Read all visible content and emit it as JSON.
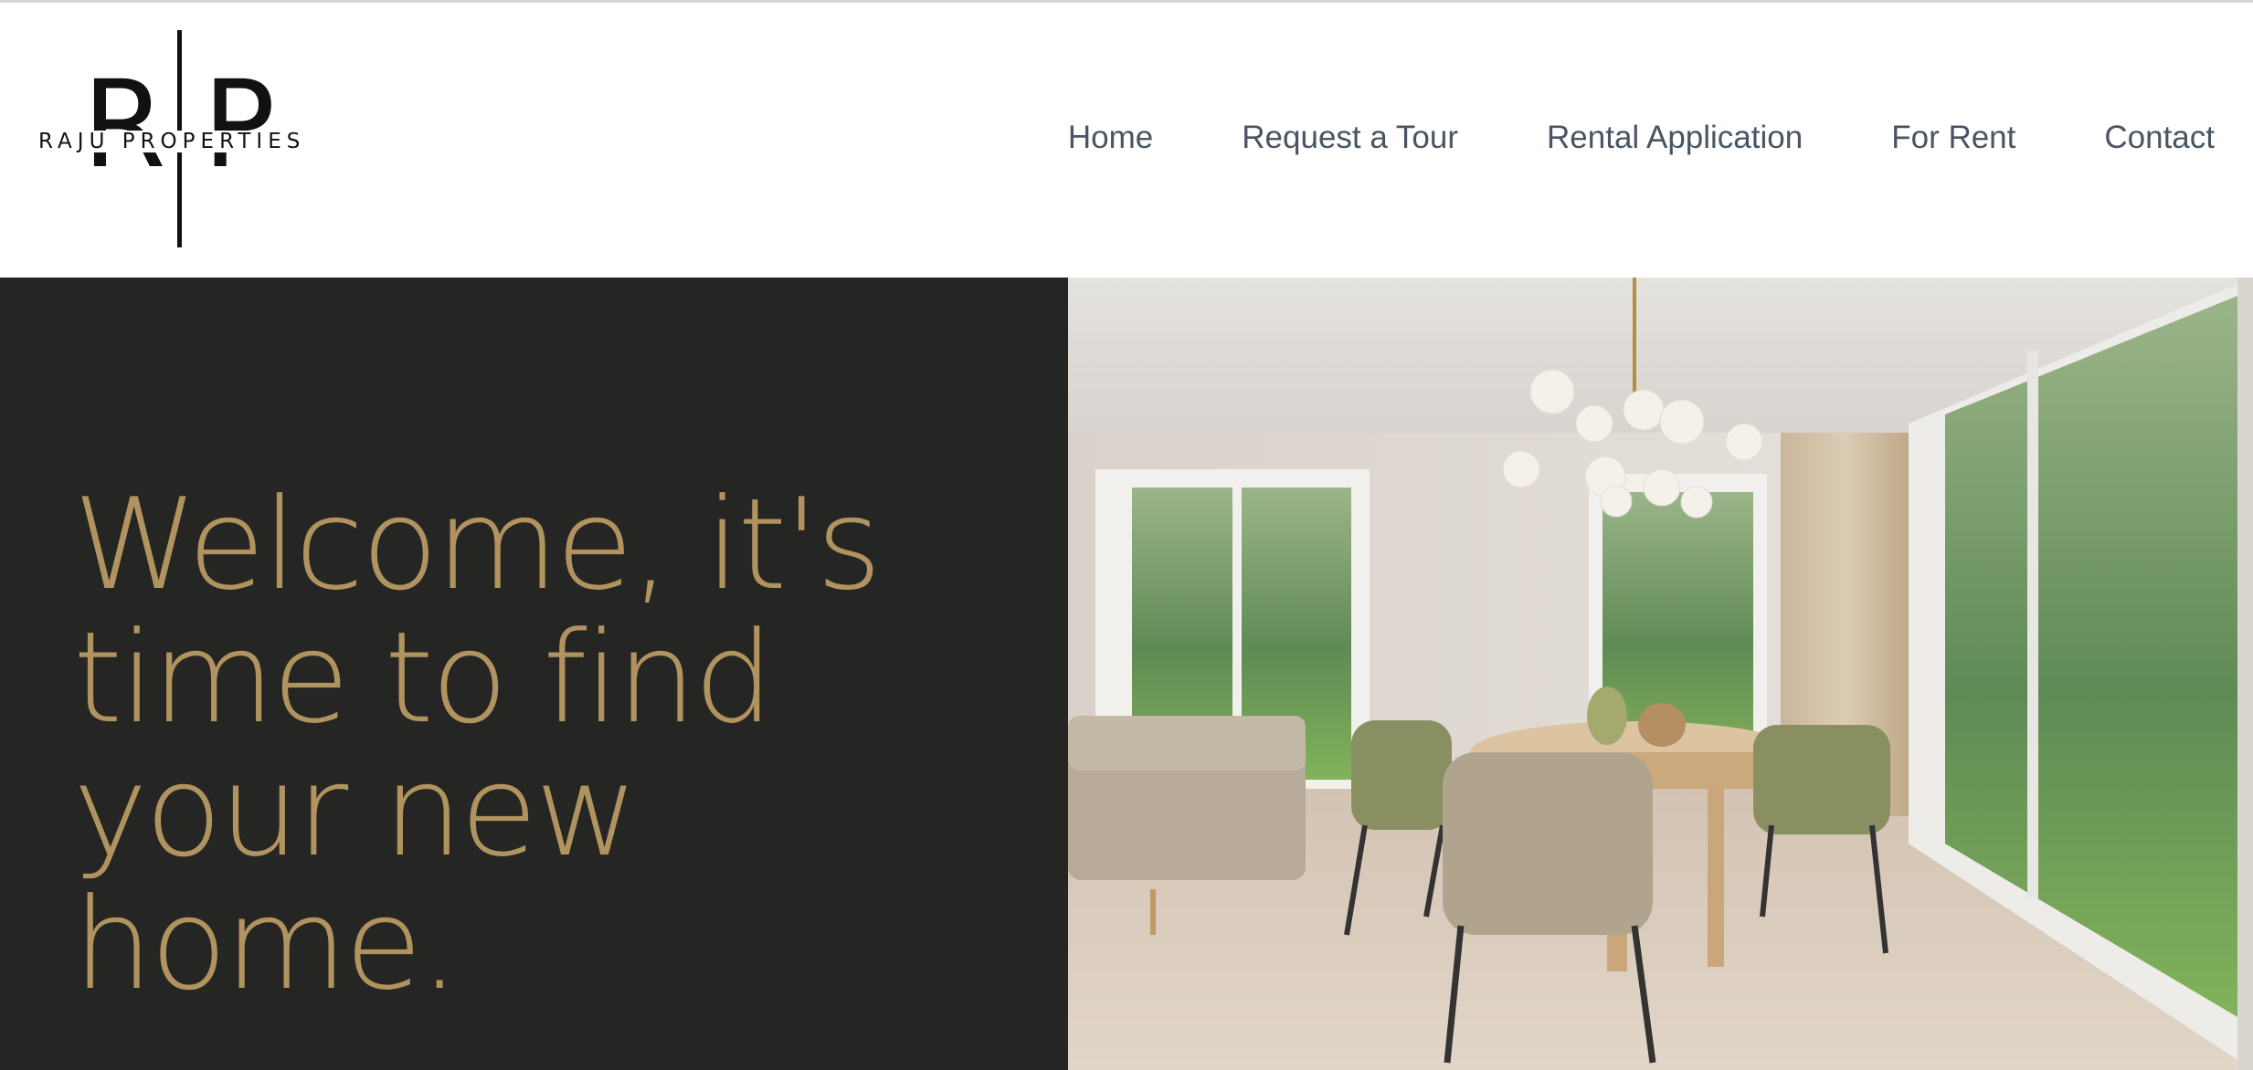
{
  "brand": {
    "logo_letters": "R P",
    "logo_wordmark": "RAJU PROPERTIES"
  },
  "nav": {
    "items": [
      {
        "label": "Home"
      },
      {
        "label": "Request a Tour"
      },
      {
        "label": "Rental Application"
      },
      {
        "label": "For Rent"
      },
      {
        "label": "Contact"
      }
    ]
  },
  "hero": {
    "title": "Welcome, it's time to find your new home.",
    "image_alt": "Dining room interior with round wooden table, upholstered chairs and globe chandelier"
  },
  "colors": {
    "hero_background": "#252624",
    "hero_title": "#b0935f",
    "nav_text": "#4a5463"
  }
}
